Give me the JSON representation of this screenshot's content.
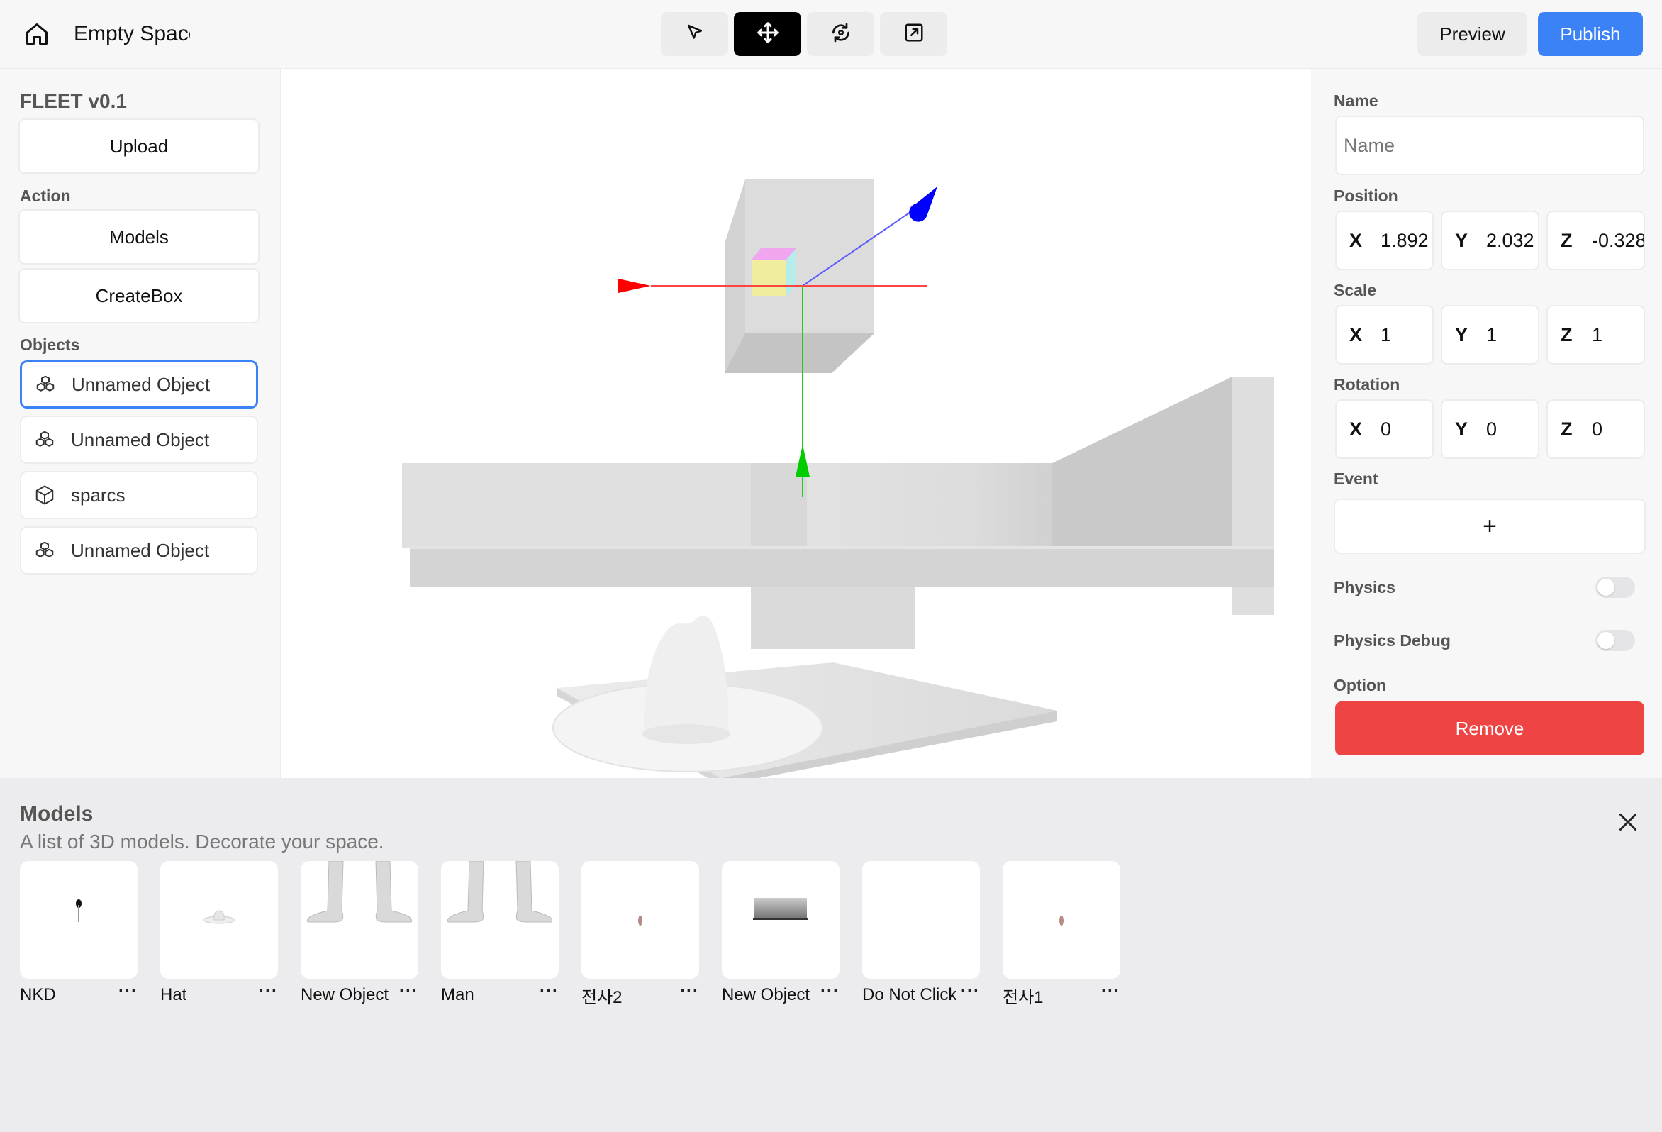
{
  "header": {
    "project_title": "Empty Space",
    "tools": [
      {
        "name": "select-tool",
        "icon": "cursor-arrow-icon",
        "active": false
      },
      {
        "name": "move-tool",
        "icon": "move-arrows-icon",
        "active": true
      },
      {
        "name": "rotate-tool",
        "icon": "rotate-icon",
        "active": false
      },
      {
        "name": "scale-tool",
        "icon": "resize-icon",
        "active": false
      }
    ],
    "preview_label": "Preview",
    "publish_label": "Publish"
  },
  "sidebar": {
    "brand": "FLEET v0.1",
    "upload_label": "Upload",
    "action_label": "Action",
    "models_label": "Models",
    "createbox_label": "CreateBox",
    "objects_label": "Objects",
    "objects": [
      {
        "label": "Unnamed Object",
        "icon": "cubes-icon",
        "selected": true
      },
      {
        "label": "Unnamed Object",
        "icon": "cubes-icon",
        "selected": false
      },
      {
        "label": "sparcs",
        "icon": "cube-icon",
        "selected": false
      },
      {
        "label": "Unnamed Object",
        "icon": "cubes-icon",
        "selected": false
      }
    ]
  },
  "props": {
    "name_label": "Name",
    "name_placeholder": "Name",
    "position_label": "Position",
    "position": {
      "x_label": "X",
      "x": "1.892",
      "y_label": "Y",
      "y": "2.032",
      "z_label": "Z",
      "z": "-0.328"
    },
    "scale_label": "Scale",
    "scale": {
      "x_label": "X",
      "x": "1",
      "y_label": "Y",
      "y": "1",
      "z_label": "Z",
      "z": "1"
    },
    "rotation_label": "Rotation",
    "rotation": {
      "x_label": "X",
      "x": "0",
      "y_label": "Y",
      "y": "0",
      "z_label": "Z",
      "z": "0"
    },
    "event_label": "Event",
    "add_event_label": "+",
    "physics_label": "Physics",
    "physics_on": false,
    "physics_debug_label": "Physics Debug",
    "physics_debug_on": false,
    "option_label": "Option",
    "remove_label": "Remove"
  },
  "drawer": {
    "title": "Models",
    "subtitle": "A list of 3D models. Decorate your space.",
    "models": [
      {
        "name": "NKD",
        "more": "···"
      },
      {
        "name": "Hat",
        "more": "···"
      },
      {
        "name": "New Object",
        "more": "···"
      },
      {
        "name": "Man",
        "more": "···"
      },
      {
        "name": "전사2",
        "more": "···"
      },
      {
        "name": "New Object",
        "more": "···"
      },
      {
        "name": "Do Not Click",
        "more": "···"
      },
      {
        "name": "전사1",
        "more": "···"
      }
    ]
  },
  "colors": {
    "accent": "#3b82f6",
    "danger": "#ef4444",
    "gizmo_x": "#ff0000",
    "gizmo_y": "#00cc00",
    "gizmo_z": "#0000ff"
  }
}
